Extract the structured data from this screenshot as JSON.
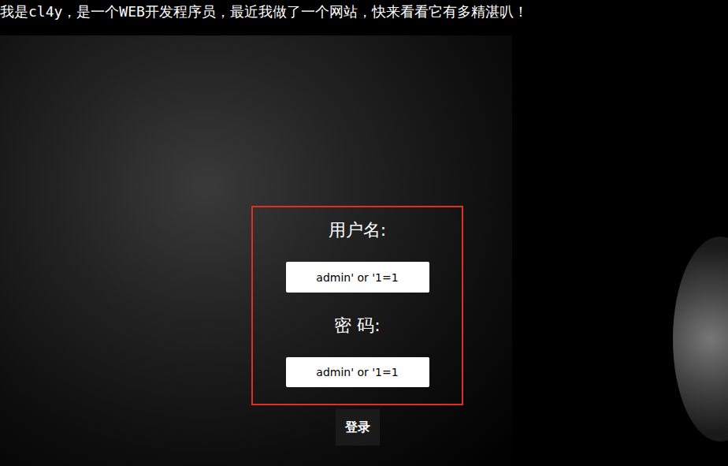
{
  "header": {
    "text": "我是cl4y，是一个WEB开发程序员，最近我做了一个网站，快来看看它有多精湛叭！"
  },
  "form": {
    "fields": [
      {
        "label": "用户名:",
        "value": "admin' or '1=1"
      },
      {
        "label": "密 码:",
        "value": "admin' or '1=1"
      }
    ],
    "submit": "登录"
  }
}
